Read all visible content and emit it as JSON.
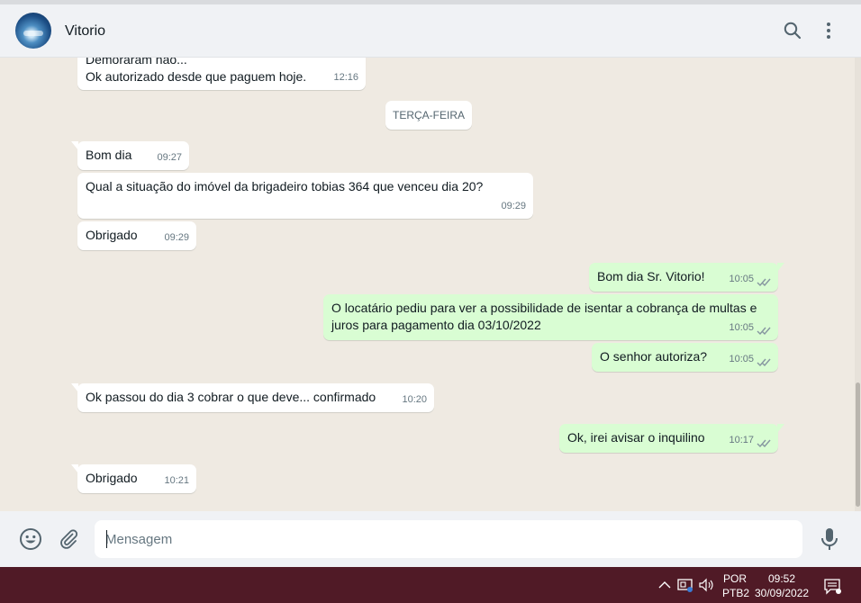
{
  "header": {
    "contact_name": "Vitorio"
  },
  "chat": {
    "partial_message": {
      "line1": "Demoraram não...",
      "line2": "Ok autorizado desde que paguem hoje.",
      "time": "12:16"
    },
    "day_separator": "TERÇA-FEIRA",
    "messages": [
      {
        "text": "Bom dia",
        "time": "09:27"
      },
      {
        "text": "Qual a situação do imóvel da brigadeiro tobias 364 que venceu dia 20?",
        "time": "09:29"
      },
      {
        "text": "Obrigado",
        "time": "09:29"
      },
      {
        "text": "Bom dia Sr. Vitorio!",
        "time": "10:05"
      },
      {
        "text": "O locatário pediu para ver a possibilidade de isentar a cobrança de multas e juros para pagamento dia 03/10/2022",
        "time": "10:05"
      },
      {
        "text": "O senhor autoriza?",
        "time": "10:05"
      },
      {
        "text": "Ok passou do dia 3 cobrar o que deve... confirmado",
        "time": "10:20"
      },
      {
        "text": "Ok, irei avisar o inquilino",
        "time": "10:17"
      },
      {
        "text": "Obrigado",
        "time": "10:21"
      }
    ]
  },
  "composer": {
    "placeholder": "Mensagem"
  },
  "taskbar": {
    "lang_line1": "POR",
    "lang_line2": "PTB2",
    "time": "09:52",
    "date": "30/09/2022"
  },
  "colors": {
    "incoming": "#ffffff",
    "outgoing": "#d9fdd3",
    "background": "#efeae2",
    "tick": "#8696a0",
    "taskbar": "#501a26"
  },
  "icons": [
    "search-icon",
    "menu-icon",
    "emoji-icon",
    "attach-icon",
    "mic-icon",
    "chevron-up-icon",
    "network-icon",
    "volume-icon",
    "notification-icon"
  ]
}
